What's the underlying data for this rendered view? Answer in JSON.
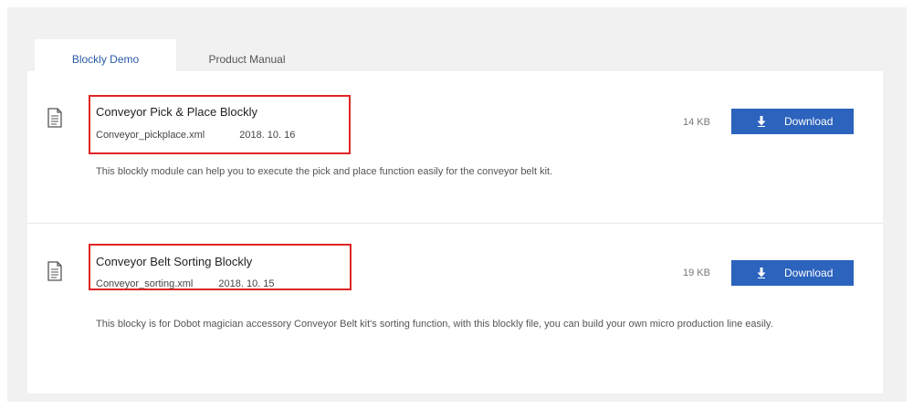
{
  "tabs": [
    {
      "label": "Blockly Demo",
      "active": true
    },
    {
      "label": "Product Manual",
      "active": false
    }
  ],
  "items": [
    {
      "title": "Conveyor Pick & Place Blockly",
      "filename": "Conveyor_pickplace.xml",
      "date": "2018. 10. 16",
      "size": "14 KB",
      "download_label": "Download",
      "description": "This blockly module can help you to execute the pick and place function easily for the conveyor belt kit."
    },
    {
      "title": "Conveyor Belt Sorting Blockly",
      "filename": "Conveyor_sorting.xml",
      "date": "2018. 10. 15",
      "size": "19 KB",
      "download_label": "Download",
      "description": "This blocky is for Dobot magician accessory Conveyor Belt kit's sorting function, with this blockly file, you can build your own micro production line easily."
    }
  ],
  "icons": {
    "file": "document-icon",
    "download": "download-arrow-icon"
  },
  "colors": {
    "accent": "#2b63bd",
    "highlight": "#e02525",
    "active_tab_text": "#2a5aa8"
  }
}
